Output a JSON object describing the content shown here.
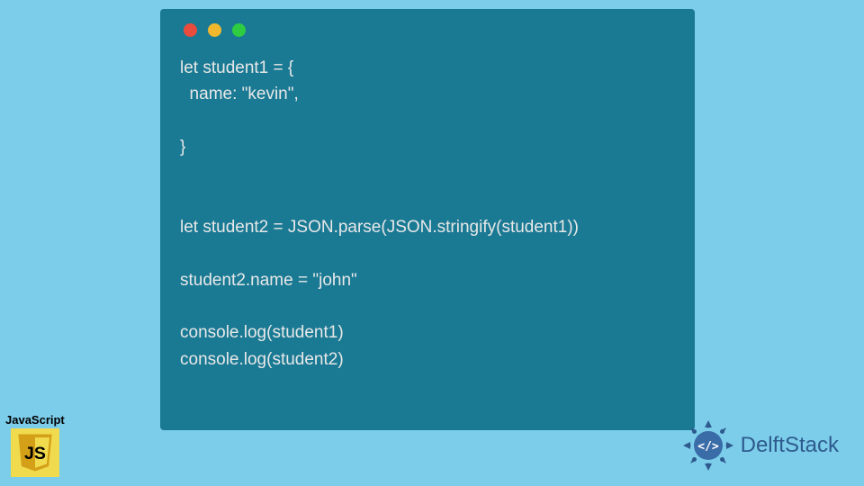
{
  "code": {
    "lines": "let student1 = {\n  name: \"kevin\",\n\n}\n\n\nlet student2 = JSON.parse(JSON.stringify(student1))\n\nstudent2.name = \"john\"\n\nconsole.log(student1)\nconsole.log(student2)"
  },
  "window": {
    "dots": [
      "red",
      "yellow",
      "green"
    ]
  },
  "jsBadge": {
    "label": "JavaScript",
    "iconText": "JS"
  },
  "delftstack": {
    "text": "DelftStack",
    "iconText": "</>"
  },
  "colors": {
    "background": "#7ccdea",
    "codeWindow": "#1a7a94",
    "codeText": "#e8e8e8",
    "jsYellow": "#f0db4f",
    "delftBlue": "#2e5a8e"
  }
}
